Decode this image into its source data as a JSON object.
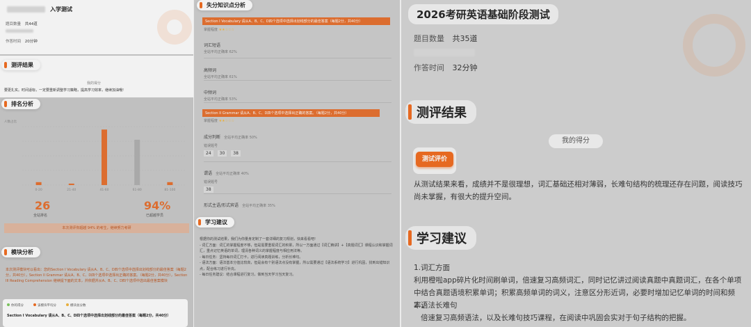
{
  "panel1": {
    "title": "入学测试",
    "question_count_label": "题目数量",
    "question_count": "共44道",
    "time_label": "作答时间",
    "time_value": "20分钟",
    "result_section": "测评结果",
    "my_score": "我的得分",
    "comment": "要更扎实。时间适标，一定要重新调整学习策略，提高学习效率，继续加油哦!",
    "rank_section": "排名分析",
    "axis_y_label": "人数占比",
    "x_ticks": [
      "0-20",
      "21-40",
      "41-60",
      "61-80",
      "81-100"
    ],
    "chart_data": {
      "type": "bar",
      "categories": [
        "0-20",
        "21-40",
        "41-60",
        "61-80",
        "81-100"
      ],
      "values": [
        2,
        1,
        38,
        31,
        2
      ],
      "xlabel": "",
      "ylabel": "人数占比"
    },
    "stat1_value": "26",
    "stat1_label": "全站排名",
    "stat2_value": "94%",
    "stat2_label": "已超越学员",
    "banner": "本次测评你超越 94% 的考生，继续努力考研",
    "module_section": "模块分析",
    "module_text": "本次测评模块可以看出：您的Section I Vocabulary 请从A、B、C、D四个选项中选择出划线部分的最佳答案（每题2分，共40分），Section II Grammar 请从A、B、C、D四个选项中选择出正确的答案。（每题2分，共40分），Section III Reading Comprehension 继续提下面的文本，并依据并从A、B、C、D四个选项中选出最佳答案模块",
    "legend": [
      "你的得分",
      "该模块平均分",
      "模块总分数"
    ],
    "legend_colors": [
      "#7dc95e",
      "#f26b1d",
      "#f5b73b"
    ],
    "module_card_title": "Section I Vocabulary 请从A、B、C、D四个选项中选择出划线部分的最佳答案（每题2分，共40分）"
  },
  "panel2": {
    "section": "失分知识点分析",
    "sec1_bar": "Section I Vocabulary 请从A、B、C、D四个选项中选择出划线部分的最佳答案（每题2分，共40分）",
    "mastery_label": "掌握程度",
    "items1": [
      {
        "name": "词汇短语",
        "note": "全站平均正确率 62%"
      },
      {
        "name": "高频词",
        "note": "全站平均正确率 61%"
      },
      {
        "name": "中频词",
        "note": "全站平均正确率 53%"
      }
    ],
    "sec2_bar": "Section II Grammar 请从A、B、C、D四个选项中选择出正确的答案。（每题2分，共40分）",
    "items2_a": {
      "name": "成分判断",
      "note": "全站平均正确率 50%",
      "sub": "错误题号",
      "nums": [
        "24",
        "30",
        "38"
      ]
    },
    "items2_b": {
      "name": "谓语",
      "note": "全站平均正确率 40%",
      "sub": "错误题号",
      "nums": [
        "38"
      ]
    },
    "items2_c": {
      "name": "形式主语/形式宾语",
      "note": "全站平均正确率 35%"
    },
    "study_section": "学习建议",
    "study_text": "根据你的测试结果，我们为你量身定制了一套详细的复习规划，快来看看吧!\n- 词汇方面：词汇的掌握程度不够，但是需要重视词汇的积累，所以一方面通过【词汇精讲】+【真题词汇】课程认识和掌握词汇，重点记忆英语的单词，理清各种词义的掌握程度与相应用法等。\n- 每日任务：坚持每日词汇打卡，进行阅读真题训练，分析长难句。\n- 语法方面：语法基本分值比较高，但是会有个别语法点没有掌握，所以需要通过【语法系统学习】进行巩固，找到出错知识点，配合练习进行补充。\n- 每日任务建议：结合课程进行复习，做到当天学习当天复习。"
  },
  "panel3": {
    "title": "2026考研英语基础阶段测试",
    "question_count_label": "题目数量",
    "question_count": "共35道",
    "time_label": "作答时间",
    "time_value": "32分钟",
    "result_section": "测评结果",
    "my_score": "我的得分",
    "eval_button": "测试评价",
    "eval_text": "从测试结果来看，成绩并不是很理想，词汇基础还相对薄弱，长难句结构的梳理还存在问题，阅读技巧尚未掌握，有很大的提升空间。",
    "study_section": "学习建议",
    "advice_1_title": "1.词汇方面",
    "advice_1_text": "利用橙啦app碎片化时间刷单词，倍速复习高频词汇，同时记忆讲过阅读真题中真题词汇，在各个单项中结合真题语境积累单词；积累高频单词的词义，注意区分形近词，必要时增加记忆单词的时间和频率。",
    "advice_2_title": "2.语法长难句",
    "advice_2_text": "倍速复习高频语法，以及长难句技巧课程，在阅读中巩固会实对于句子结构的把握。"
  }
}
